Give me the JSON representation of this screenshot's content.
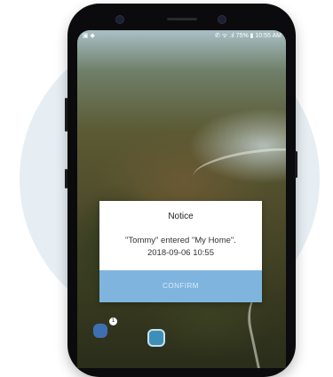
{
  "status_bar": {
    "left_icons": "▣ ◆",
    "right": "✆ ᯤ .ıl 75% ▮ 10:55 AM"
  },
  "dialog": {
    "title": "Notice",
    "message_line1": "\"Tommy\" entered \"My Home\".",
    "message_line2": "2018-09-06 10:55",
    "confirm_label": "CONFIRM"
  },
  "home": {
    "badge_count": "1"
  },
  "colors": {
    "confirm_button": "#7fb4de",
    "background_circle": "#e6eef3",
    "phone_frame": "#0b0b0d"
  }
}
